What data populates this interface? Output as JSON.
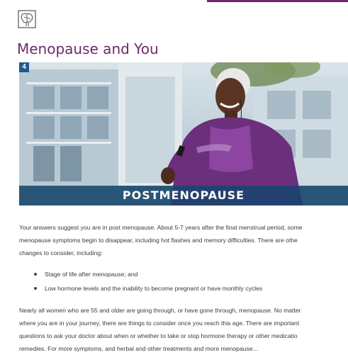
{
  "header": {
    "logo_icon": "brain-logo-icon",
    "title": "Menopause and You",
    "accent_color": "#6d2a6b"
  },
  "hero": {
    "step_number": "4",
    "banner_text": "POSTMENOPAUSE",
    "banner_color": "#14466e"
  },
  "body": {
    "paragraph1": [
      "Your answers suggest you are in post menopause. About 5-7 years after the final menstrual period, some",
      "menopause symptoms begin to disappear, including hot flashes and memory difficulties. There are othe",
      "changes to consider, including:"
    ],
    "bullets": [
      "Stage of life after menopause; and",
      "Low hormone levels and the inability to become pregnant or have monthly cycles"
    ],
    "paragraph2": [
      "Nearly all women who are 55 and older are going through, or have gone through, menopause. No matter",
      "where you are in your journey, there are things to consider once you reach this age. There are important",
      "questions to ask your doctor about when or whether to take or stop hormone therapy or other medicatio",
      "remedies. For more symptoms, and herbal and other treatments and more menopause..."
    ]
  }
}
